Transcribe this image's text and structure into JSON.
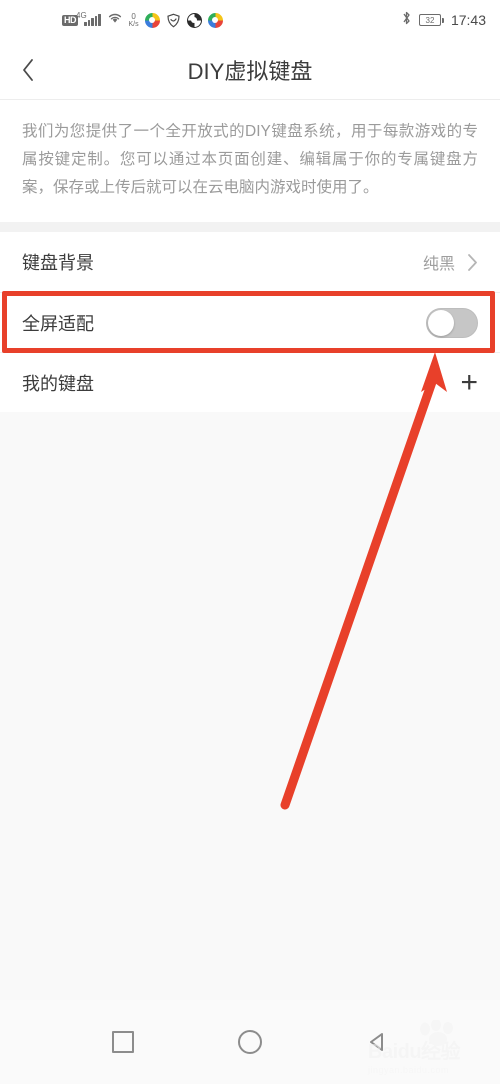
{
  "statusbar": {
    "hd_badge": "HD",
    "network_type": "4G",
    "netspeed_value": "0",
    "netspeed_unit": "K/s",
    "battery_level": "32",
    "time": "17:43",
    "icons": [
      "hd-icon",
      "signal-4g-icon",
      "wifi-icon",
      "network-speed-icon",
      "app-notification-icon",
      "shield-notification-icon",
      "app-notification-icon",
      "app-notification-icon",
      "bluetooth-icon",
      "battery-icon"
    ]
  },
  "titlebar": {
    "back_icon": "chevron-left-icon",
    "title": "DIY虚拟键盘"
  },
  "description": {
    "text": "我们为您提供了一个全开放式的DIY键盘系统，用于每款游戏的专属按键定制。您可以通过本页面创建、编辑属于你的专属键盘方案，保存或上传后就可以在云电脑内游戏时使用了。"
  },
  "settings": {
    "rows": [
      {
        "label": "键盘背景",
        "value": "纯黑",
        "accessory": "chevron-right-icon"
      },
      {
        "label": "全屏适配",
        "accessory": "toggle-switch",
        "toggle_state": "off",
        "highlighted": true
      },
      {
        "label": "我的键盘",
        "accessory": "plus-icon"
      }
    ]
  },
  "annotations": {
    "highlight_color": "#e8402a",
    "box_target": "全屏适配",
    "arrow_points_to": "全屏适配 toggle"
  },
  "navbar": {
    "recents_label": "recents-square-icon",
    "home_label": "home-circle-icon",
    "back_label": "back-triangle-icon"
  },
  "watermark": {
    "main": "Baidu经验",
    "sub": "jingyan.baidu.com"
  }
}
